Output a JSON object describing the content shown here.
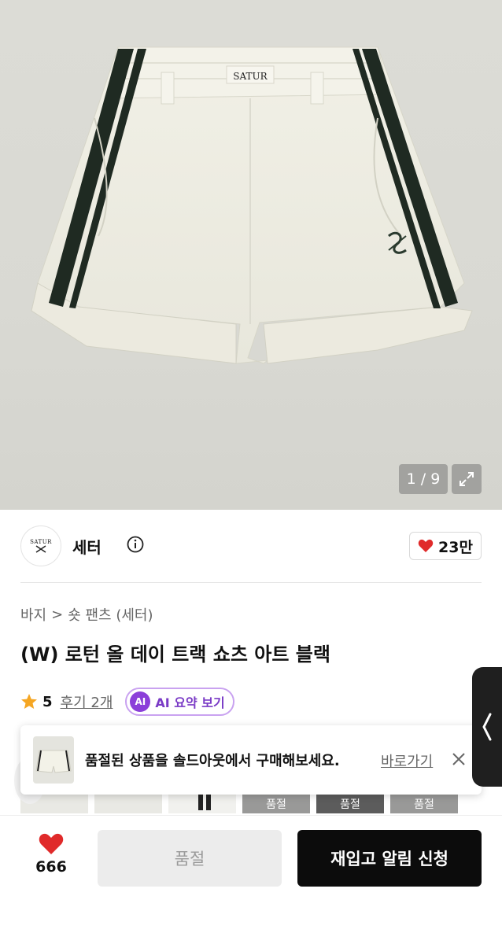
{
  "gallery": {
    "counter": "1 / 9",
    "garment_label": "SATUR"
  },
  "brand": {
    "logo_text": "SATUR",
    "name": "세터",
    "likes": "23만"
  },
  "breadcrumb": {
    "root": "바지",
    "child": "숏 팬츠 (세터)",
    "separator": ">"
  },
  "product": {
    "title": "(W) 로턴 올 데이 트랙 쇼츠 아트 블랙"
  },
  "rating": {
    "score": "5",
    "reviews_label": "후기 2개",
    "ai_badge": "AI",
    "ai_label": "AI 요약 보기"
  },
  "toast": {
    "message": "품절된 상품을 솔드아웃에서 구매해보세요.",
    "action": "바로가기"
  },
  "thumbnails": {
    "soldout_label": "품절"
  },
  "bottom_bar": {
    "wish_count": "666",
    "soldout_button": "품절",
    "restock_button": "재입고 알림 신청"
  },
  "colors": {
    "accent_red": "#e02a2a",
    "ai_purple": "#8b3fd9",
    "star": "#f5a623",
    "primary_button": "#0c0c0c"
  }
}
